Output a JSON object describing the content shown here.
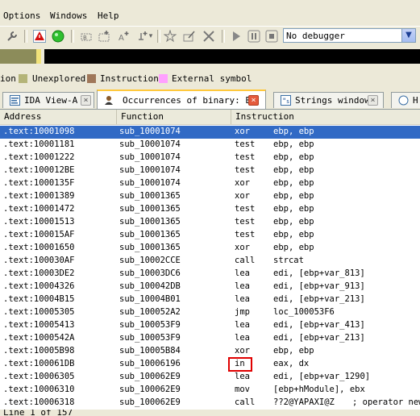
{
  "menubar": {
    "items": [
      "Options",
      "Windows",
      "Help"
    ]
  },
  "toolbar": {
    "debugger_select": "No debugger",
    "icons": [
      "wrench-icon",
      "warning-icon",
      "run-green-icon",
      "patch-icon",
      "add-icon",
      "add-icon",
      "define-icon",
      "define-icon",
      "star-icon",
      "edit-icon",
      "close-icon",
      "play-icon",
      "pause-icon",
      "stop-icon"
    ]
  },
  "legend": {
    "items": [
      {
        "label": "ion",
        "color": null
      },
      {
        "label": "Unexplored",
        "color": "#b4b478"
      },
      {
        "label": "Instruction",
        "color": "#a0785a"
      },
      {
        "label": "External symbol",
        "color": "#ffa0ff"
      }
    ]
  },
  "tabs": [
    {
      "label": "IDA View-A",
      "close": "grey",
      "active": false
    },
    {
      "label": "Occurrences of binary: ED",
      "close": "red",
      "active": true
    },
    {
      "label": "Strings window",
      "close": "grey",
      "active": false
    },
    {
      "label": "H",
      "close": null,
      "active": false
    }
  ],
  "table": {
    "columns": [
      "Address",
      "Function",
      "Instruction"
    ],
    "rows": [
      [
        ".text:10001098",
        "sub_10001074",
        "xor",
        "ebp, ebp",
        ""
      ],
      [
        ".text:10001181",
        "sub_10001074",
        "test",
        "ebp, ebp",
        ""
      ],
      [
        ".text:10001222",
        "sub_10001074",
        "test",
        "ebp, ebp",
        ""
      ],
      [
        ".text:100012BE",
        "sub_10001074",
        "test",
        "ebp, ebp",
        ""
      ],
      [
        ".text:1000135F",
        "sub_10001074",
        "xor",
        "ebp, ebp",
        ""
      ],
      [
        ".text:10001389",
        "sub_10001365",
        "xor",
        "ebp, ebp",
        ""
      ],
      [
        ".text:10001472",
        "sub_10001365",
        "test",
        "ebp, ebp",
        ""
      ],
      [
        ".text:10001513",
        "sub_10001365",
        "test",
        "ebp, ebp",
        ""
      ],
      [
        ".text:100015AF",
        "sub_10001365",
        "test",
        "ebp, ebp",
        ""
      ],
      [
        ".text:10001650",
        "sub_10001365",
        "xor",
        "ebp, ebp",
        ""
      ],
      [
        ".text:100030AF",
        "sub_10002CCE",
        "call",
        "strcat",
        ""
      ],
      [
        ".text:10003DE2",
        "sub_10003DC6",
        "lea",
        "edi, [ebp+var_813]",
        ""
      ],
      [
        ".text:10004326",
        "sub_100042DB",
        "lea",
        "edi, [ebp+var_913]",
        ""
      ],
      [
        ".text:10004B15",
        "sub_10004B01",
        "lea",
        "edi, [ebp+var_213]",
        ""
      ],
      [
        ".text:10005305",
        "sub_100052A2",
        "jmp",
        "loc_100053F6",
        ""
      ],
      [
        ".text:10005413",
        "sub_100053F9",
        "lea",
        "edi, [ebp+var_413]",
        ""
      ],
      [
        ".text:1000542A",
        "sub_100053F9",
        "lea",
        "edi, [ebp+var_213]",
        ""
      ],
      [
        ".text:10005B98",
        "sub_10005B84",
        "xor",
        "ebp, ebp",
        ""
      ],
      [
        ".text:100061DB",
        "sub_10006196",
        "in",
        "eax, dx",
        ""
      ],
      [
        ".text:10006305",
        "sub_100062E9",
        "lea",
        "edi, [ebp+var_1290]",
        ""
      ],
      [
        ".text:10006310",
        "sub_100062E9",
        "mov",
        "[ebp+hModule], ebx",
        ""
      ],
      [
        ".text:10006318",
        "sub_100062E9",
        "call",
        "??2@YAPAXI@Z",
        "; operator new"
      ]
    ],
    "selected_row": 0,
    "highlighted_row": 18
  },
  "statusbar": {
    "text": "Line 1 of 157"
  }
}
